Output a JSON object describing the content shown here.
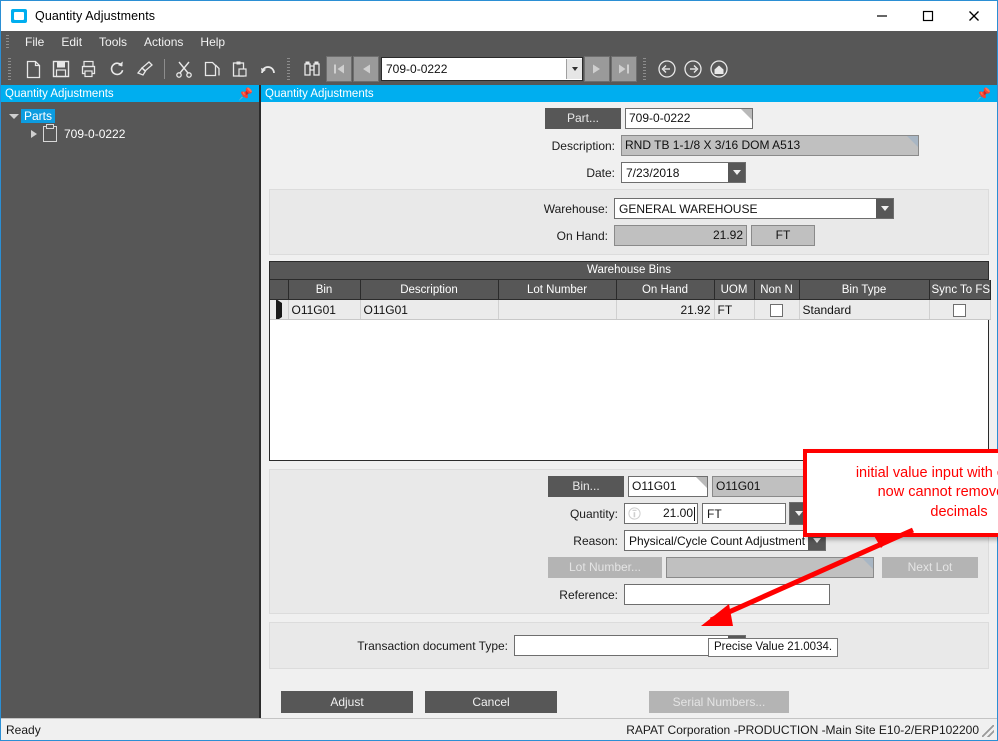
{
  "window": {
    "title": "Quantity Adjustments",
    "icon": "app-window-icon",
    "minimize": "minimize-icon",
    "maximize": "maximize-icon",
    "close": "close-icon"
  },
  "menubar": {
    "items": [
      "File",
      "Edit",
      "Tools",
      "Actions",
      "Help"
    ]
  },
  "toolbar": {
    "icons": [
      "new-document-icon",
      "save-icon",
      "print-icon",
      "refresh-icon",
      "clear-icon",
      "cut-icon",
      "copy-icon",
      "paste-icon",
      "undo-icon",
      "binoculars-search-icon",
      "first-record-icon",
      "previous-record-icon",
      "next-record-icon",
      "last-record-icon",
      "back-icon",
      "forward-icon",
      "home-icon"
    ],
    "search_value": "709-0-0222",
    "search_placeholder": ""
  },
  "sidebar": {
    "header": "Quantity Adjustments",
    "pin": "pin-icon",
    "tree": {
      "root_label": "Parts",
      "child_label": "709-0-0222"
    }
  },
  "main": {
    "header": "Quantity Adjustments",
    "pin": "pin-icon",
    "part": {
      "button_label": "Part...",
      "value": "709-0-0222"
    },
    "description": {
      "label": "Description:",
      "value": "RND TB 1-1/8 X 3/16 DOM A513"
    },
    "date": {
      "label": "Date:",
      "value": "7/23/2018"
    },
    "warehouse": {
      "label": "Warehouse:",
      "value": "GENERAL WAREHOUSE"
    },
    "on_hand": {
      "label": "On Hand:",
      "value": "21.92",
      "uom": "FT"
    },
    "grid": {
      "caption": "Warehouse Bins",
      "columns": [
        "Bin",
        "Description",
        "Lot Number",
        "On Hand",
        "UOM",
        "Non N",
        "Bin Type",
        "Sync To FSA"
      ],
      "rows": [
        {
          "bin": "O11G01",
          "description": "O11G01",
          "lot_number": "",
          "on_hand": "21.92",
          "uom": "FT",
          "non_n": false,
          "bin_type": "Standard",
          "sync_to_fsa": false
        }
      ]
    },
    "detail": {
      "bin": {
        "button_label": "Bin...",
        "value": "O11G01",
        "description": "O11G01"
      },
      "quantity": {
        "label": "Quantity:",
        "value": "21.00",
        "uom": "FT",
        "calculator_icon": "calculator-icon"
      },
      "reason": {
        "label": "Reason:",
        "value": "Physical/Cycle Count Adjustment"
      },
      "lot_number": {
        "button_label": "Lot Number...",
        "value": "",
        "next_lot_label": "Next Lot"
      },
      "reference": {
        "label": "Reference:",
        "value": ""
      }
    },
    "transaction_document_type": {
      "label": "Transaction document Type:",
      "value": ""
    },
    "buttons": {
      "adjust": "Adjust",
      "cancel": "Cancel",
      "serial_numbers": "Serial Numbers..."
    }
  },
  "tooltip": {
    "text": "Precise Value 21.0034."
  },
  "annotation": {
    "line1": "initial value input with calculator,",
    "line2": "now cannot remove extra",
    "line3": "decimals",
    "color": "#ff0000"
  },
  "statusbar": {
    "left": "Ready",
    "right": "RAPAT Corporation -PRODUCTION -Main Site  E10-2/ERP102200"
  },
  "colors": {
    "accent_blue": "#00aeef",
    "chrome_dark": "#575757",
    "form_bg": "#f0f0f0",
    "annotation_red": "#ff0000"
  }
}
